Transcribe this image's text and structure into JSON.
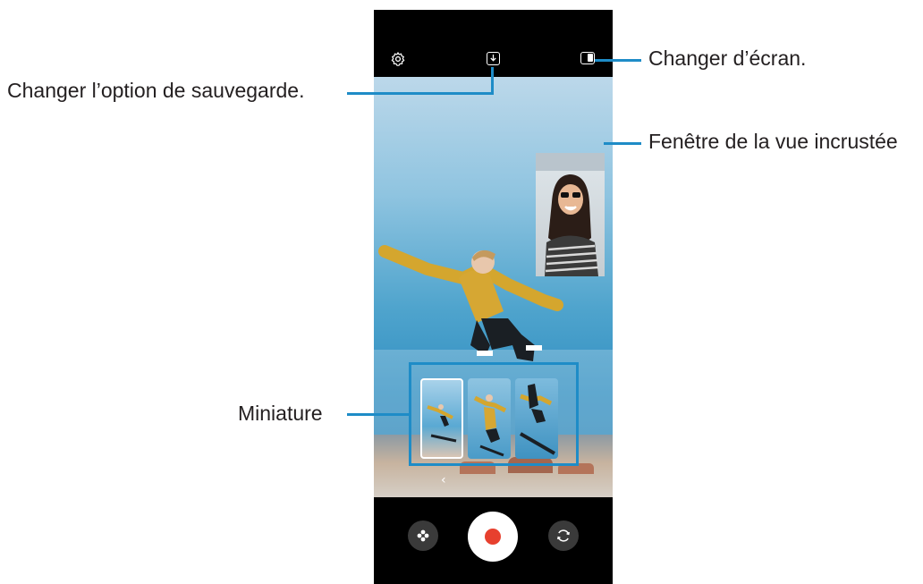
{
  "callouts": {
    "save_option": "Changer l’option de sauvegarde.",
    "change_screen": "Changer d’écran.",
    "pip_window": "Fenêtre de la vue incrustée",
    "thumbnail": "Miniature"
  },
  "toolbar": {
    "settings_icon": "gear-icon",
    "save_icon": "download-icon",
    "screen_icon": "screen-layout-icon"
  },
  "controls": {
    "effects_icon": "effects-icon",
    "record_icon": "record-icon",
    "switch_icon": "switch-camera-icon",
    "back_icon": "chevron-left-icon"
  },
  "colors": {
    "callout": "#1e8cc7",
    "record": "#e7402e",
    "phone_frame": "#000000"
  }
}
